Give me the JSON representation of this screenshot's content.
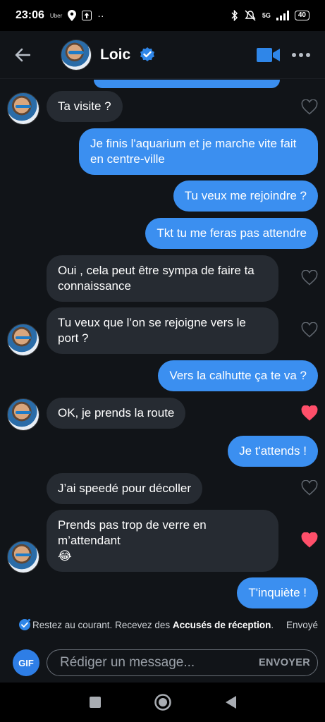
{
  "status": {
    "time": "23:06",
    "carrier_note": "Uber",
    "network": "5G",
    "battery": "40"
  },
  "header": {
    "contact_name": "Loic"
  },
  "messages": [
    {
      "dir": "in",
      "text": "Ta visite ?",
      "avatar": true,
      "liked": false
    },
    {
      "dir": "out",
      "text": "Je finis l'aquarium et je marche vite fait en centre-ville"
    },
    {
      "dir": "out",
      "text": "Tu veux me rejoindre ?"
    },
    {
      "dir": "out",
      "text": "Tkt tu me feras pas attendre"
    },
    {
      "dir": "in",
      "text": "Oui , cela peut être sympa de faire ta connaissance",
      "avatar": false,
      "liked": false
    },
    {
      "dir": "in",
      "text": "Tu veux que l’on se rejoigne vers le port ?",
      "avatar": true,
      "liked": false
    },
    {
      "dir": "out",
      "text": "Vers la calhutte ça te va ?"
    },
    {
      "dir": "in",
      "text": "OK, je prends la route",
      "avatar": true,
      "liked": true
    },
    {
      "dir": "out",
      "text": "Je t'attends !"
    },
    {
      "dir": "in",
      "text": "J’ai speedé pour décoller",
      "avatar": false,
      "liked": false
    },
    {
      "dir": "in",
      "text": "Prends pas trop de verre en m’attendant",
      "emoji": "😂",
      "avatar": true,
      "liked": true
    },
    {
      "dir": "out",
      "text": "T'inquiète !"
    }
  ],
  "receipts": {
    "prefix": "Restez au courant. Recevez des ",
    "bold": "Accusés de réception",
    "suffix": ".",
    "status": "Envoyé"
  },
  "composer": {
    "gif_label": "GIF",
    "placeholder": "Rédiger un message...",
    "send_label": "ENVOYER"
  },
  "colors": {
    "outgoing_bubble": "#3b8ff0",
    "incoming_bubble": "#262b32",
    "like_active": "#ff4f6a",
    "background": "#111418"
  },
  "icons": [
    "back-arrow-icon",
    "verified-badge-icon",
    "video-call-icon",
    "more-options-icon",
    "heart-icon",
    "read-receipt-icon",
    "square-nav-icon",
    "home-nav-icon",
    "back-nav-icon"
  ]
}
